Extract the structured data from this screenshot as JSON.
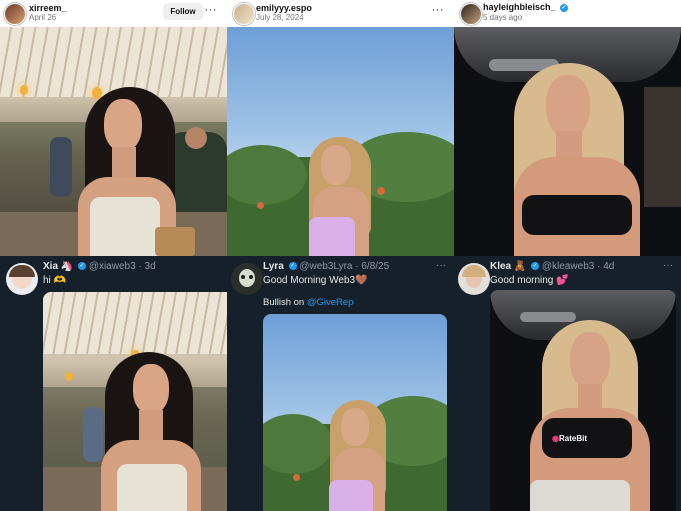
{
  "col1": {
    "ig": {
      "username": "xirreem_",
      "date": "April 26",
      "follow_label": "Follow",
      "more": "···"
    },
    "tweet": {
      "name": "Xia",
      "name_emoji": "🦄",
      "handle": "@xiaweb3",
      "time": "· 3d",
      "text": "hi 🫶"
    }
  },
  "col2": {
    "ig": {
      "username": "emilyyy.espo",
      "date": "July 28, 2024",
      "more": "···"
    },
    "tweet": {
      "name": "Lyra",
      "handle": "@web3Lyra",
      "time": "· 6/8/25",
      "text": "Good Morning Web3🤎",
      "text2_prefix": "Bullish on ",
      "mention": "@GiveRep",
      "more": "···"
    }
  },
  "col3": {
    "ig": {
      "username": "hayleighbleisch_",
      "date": "5 days ago"
    },
    "tweet": {
      "name": "Klea",
      "name_emoji": "🧸",
      "handle": "@kleaweb3",
      "time": "· 4d",
      "text": "Good morning 💕",
      "more": "···",
      "shirt_brand": "RateBit"
    }
  },
  "colors": {
    "twitter_bg": "#15202b",
    "verified": "#1d9bf0",
    "mention": "#1d9bf0"
  }
}
